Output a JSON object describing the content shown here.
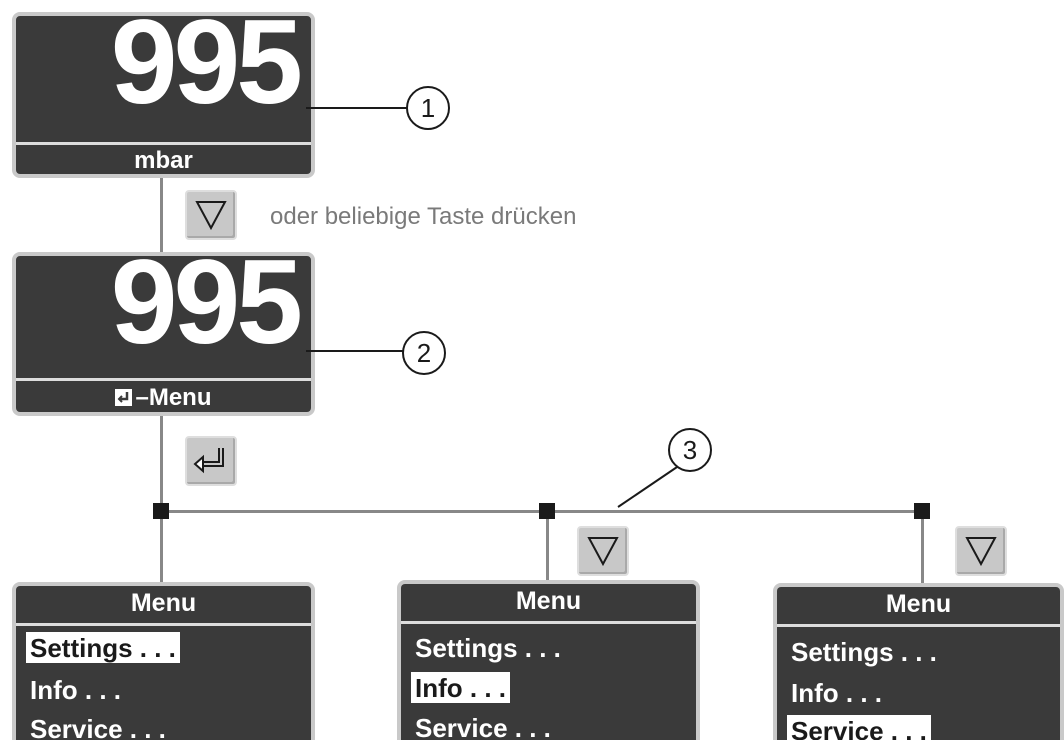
{
  "display1": {
    "value": "995",
    "unit": "mbar"
  },
  "display2": {
    "value": "995",
    "unit": "–Menu",
    "unit_icon": "enter-icon"
  },
  "hint": "oder beliebige Taste drücken",
  "callouts": [
    "1",
    "2",
    "3"
  ],
  "keys": {
    "down": "down-arrow-key",
    "enter": "enter-key"
  },
  "menus": [
    {
      "title": "Menu",
      "items": [
        "Settings . . .",
        "Info . . .",
        "Service . . ."
      ],
      "selected": 0
    },
    {
      "title": "Menu",
      "items": [
        "Settings . . .",
        "Info . . .",
        "Service . . ."
      ],
      "selected": 1
    },
    {
      "title": "Menu",
      "items": [
        "Settings . . .",
        "Info . . .",
        "Service . . ."
      ],
      "selected": 2
    }
  ],
  "colors": {
    "panel": "#3a3a3a",
    "panel_border": "#c9c9c9",
    "line": "#888888",
    "key": "#c8c8c8",
    "hint": "#7a7a7a"
  }
}
